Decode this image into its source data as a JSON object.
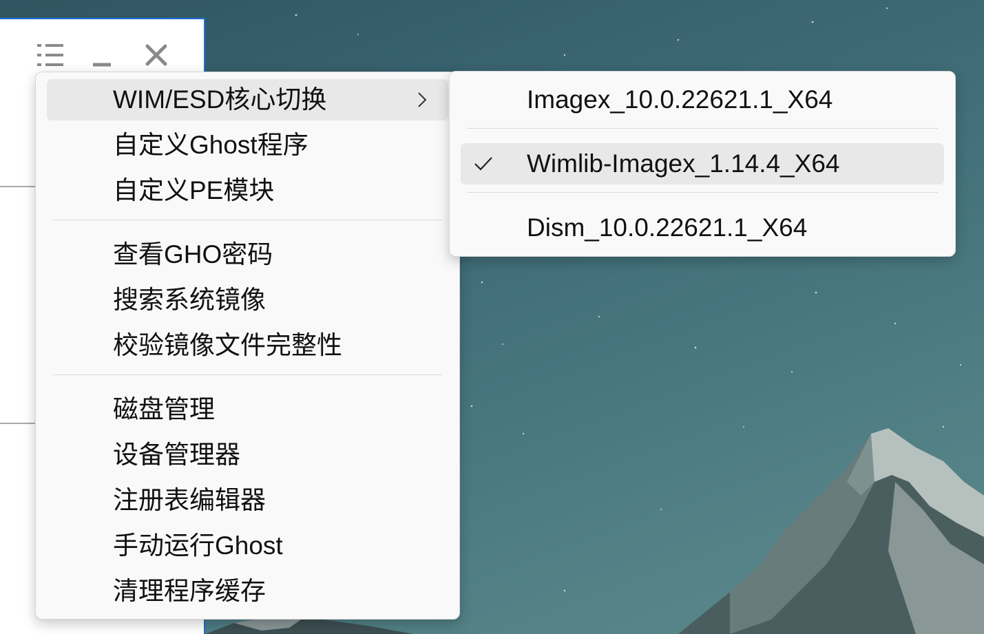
{
  "colors": {
    "window_border": "#1f6fd1",
    "menu_background": "#f9f9f9",
    "highlight": "#e8e8e8",
    "text": "#111111"
  },
  "app_window": {
    "title_buttons": [
      {
        "name": "menu-list-icon"
      },
      {
        "name": "minimize-icon"
      },
      {
        "name": "close-icon"
      }
    ]
  },
  "main_menu": {
    "items": [
      {
        "label": "WIM/ESD核心切换",
        "has_submenu": true,
        "active": true
      },
      {
        "label": "自定义Ghost程序"
      },
      {
        "label": "自定义PE模块"
      },
      {
        "label": "查看GHO密码"
      },
      {
        "label": "搜索系统镜像"
      },
      {
        "label": "校验镜像文件完整性"
      },
      {
        "label": "磁盘管理"
      },
      {
        "label": "设备管理器"
      },
      {
        "label": "注册表编辑器"
      },
      {
        "label": "手动运行Ghost"
      },
      {
        "label": "清理程序缓存"
      }
    ]
  },
  "sub_menu": {
    "items": [
      {
        "label": "Imagex_10.0.22621.1_X64",
        "checked": false
      },
      {
        "label": "Wimlib-Imagex_1.14.4_X64",
        "checked": true
      },
      {
        "label": "Dism_10.0.22621.1_X64",
        "checked": false
      }
    ]
  }
}
